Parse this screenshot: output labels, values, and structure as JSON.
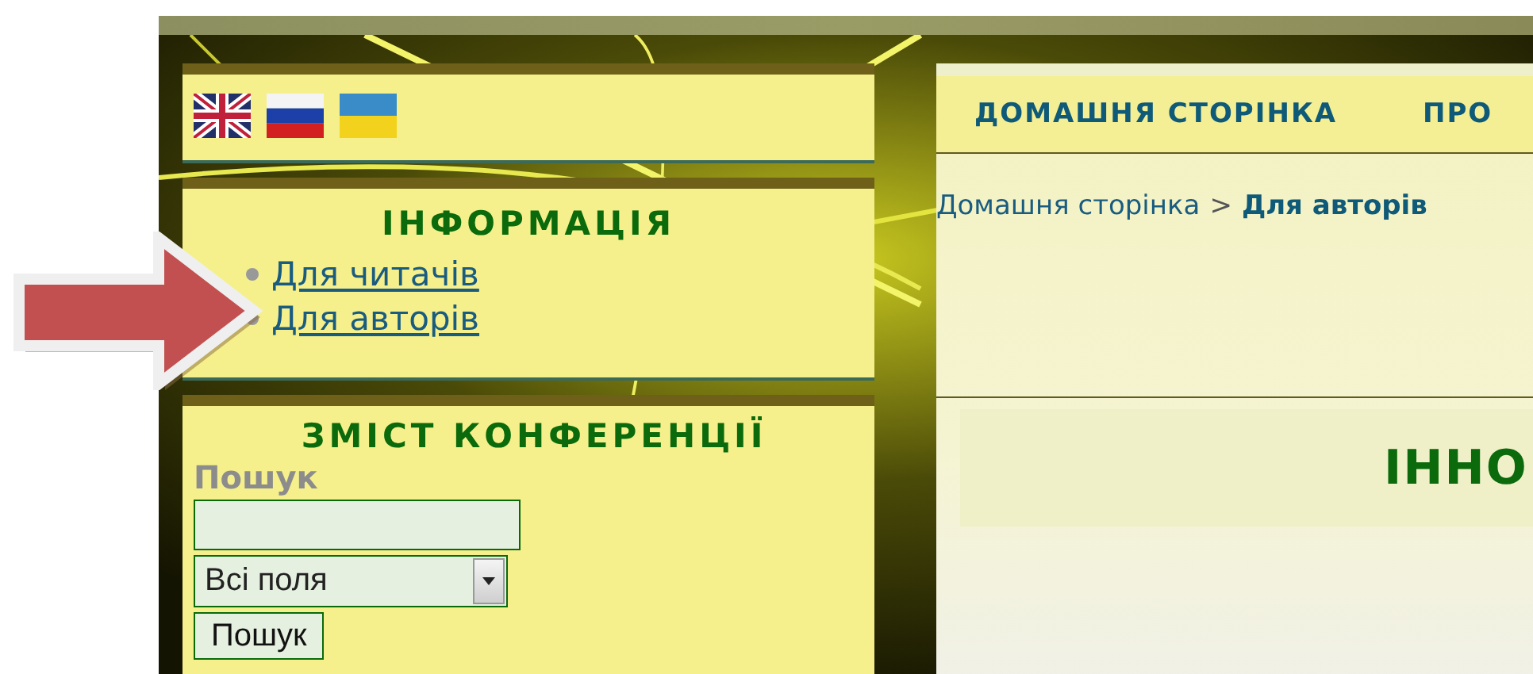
{
  "languages": {
    "flags": [
      {
        "kind": "uk"
      },
      {
        "kind": "ru"
      },
      {
        "kind": "ua"
      }
    ]
  },
  "information": {
    "title": "ІНФОРМАЦІЯ",
    "links": [
      {
        "label": "Для читачів"
      },
      {
        "label": "Для авторів"
      }
    ]
  },
  "contents": {
    "title": "ЗМІСТ КОНФЕРЕНЦІЇ",
    "search_label": "Пошук",
    "scope_select": {
      "value": "Всі поля"
    },
    "search_button": "Пошук"
  },
  "nav": {
    "items": [
      {
        "label": "ДОМАШНЯ СТОРІНКА"
      },
      {
        "label": "ПРО"
      }
    ]
  },
  "breadcrumb": {
    "link": "Домашня сторінка",
    "separator": ">",
    "current": "Для авторів"
  },
  "main": {
    "title": "ІННО"
  }
}
